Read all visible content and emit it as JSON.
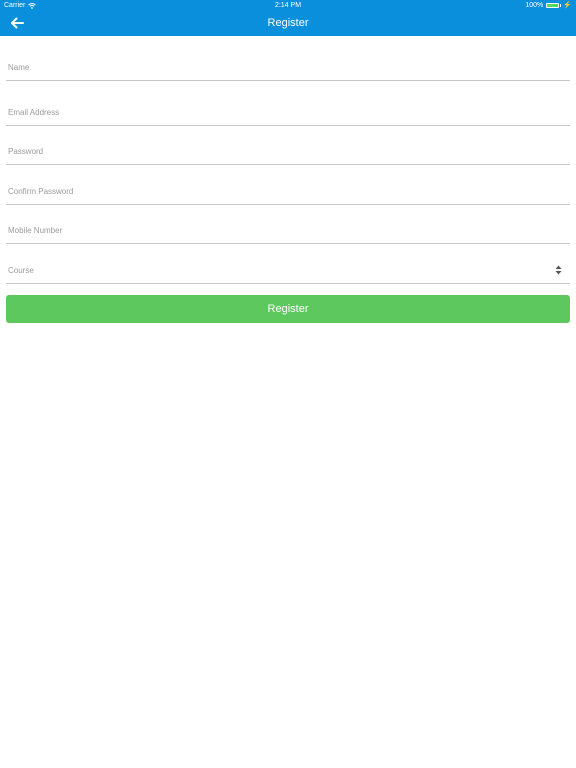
{
  "status_bar": {
    "carrier": "Carrier",
    "time": "2:14 PM",
    "battery": "100%",
    "battery_level": 1.0
  },
  "nav": {
    "title": "Register"
  },
  "form": {
    "name_placeholder": "Name",
    "email_placeholder": "Email Address",
    "password_placeholder": "Password",
    "confirm_password_placeholder": "Confirm Password",
    "mobile_placeholder": "Mobile Number",
    "course_placeholder": "Course"
  },
  "actions": {
    "register_label": "Register"
  },
  "colors": {
    "nav_bg": "#0a8fdd",
    "button_bg": "#5cc85e",
    "battery_fill": "#4cd964"
  },
  "icons": {
    "back": "arrow-left-icon",
    "wifi": "wifi-icon",
    "battery": "battery-icon",
    "charging": "charging-icon",
    "stepper": "up-down-stepper-icon"
  }
}
